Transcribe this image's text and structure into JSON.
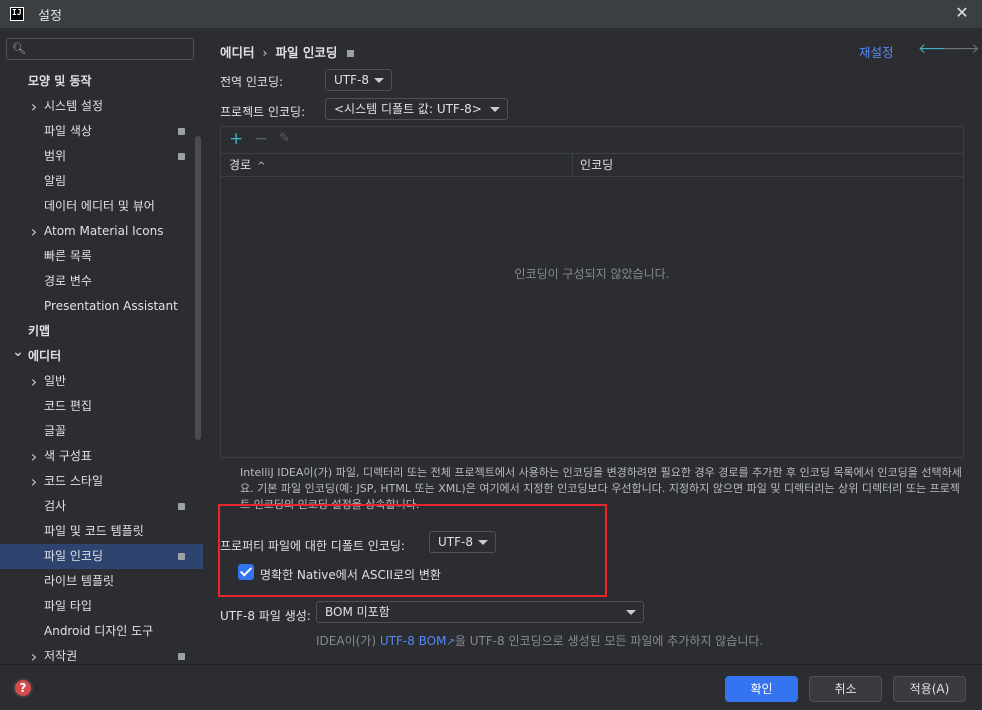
{
  "window": {
    "title": "설정",
    "logo": "IJ"
  },
  "search": {
    "placeholder": "",
    "value": ""
  },
  "sidebar": {
    "items": [
      {
        "label": "모양 및 동작",
        "bold": true,
        "level": 0
      },
      {
        "label": "시스템 설정",
        "arrow": "collapsed",
        "level": 1
      },
      {
        "label": "파일 색상",
        "level": 1,
        "badge": true
      },
      {
        "label": "범위",
        "level": 1,
        "badge": true
      },
      {
        "label": "알림",
        "level": 1
      },
      {
        "label": "데이터 에디터 및 뷰어",
        "level": 1
      },
      {
        "label": "Atom Material Icons",
        "arrow": "collapsed",
        "level": 1
      },
      {
        "label": "빠른 목록",
        "level": 1
      },
      {
        "label": "경로 변수",
        "level": 1
      },
      {
        "label": "Presentation Assistant",
        "level": 1
      },
      {
        "label": "키맵",
        "bold": true,
        "level": 0
      },
      {
        "label": "에디터",
        "bold": true,
        "arrow": "expanded",
        "level": 0
      },
      {
        "label": "일반",
        "arrow": "collapsed",
        "level": 1
      },
      {
        "label": "코드 편집",
        "level": 1
      },
      {
        "label": "글꼴",
        "level": 1
      },
      {
        "label": "색 구성표",
        "arrow": "collapsed",
        "level": 1
      },
      {
        "label": "코드 스타일",
        "arrow": "collapsed",
        "level": 1
      },
      {
        "label": "검사",
        "level": 1,
        "badge": true
      },
      {
        "label": "파일 및 코드 템플릿",
        "level": 1
      },
      {
        "label": "파일 인코딩",
        "level": 1,
        "badge": true,
        "selected": true
      },
      {
        "label": "라이브 템플릿",
        "level": 1
      },
      {
        "label": "파일 타입",
        "level": 1
      },
      {
        "label": "Android 디자인 도구",
        "level": 1
      },
      {
        "label": "저작권",
        "arrow": "collapsed",
        "level": 1,
        "badge": true
      }
    ]
  },
  "breadcrumb": {
    "parent": "에디터",
    "separator": "›",
    "current": "파일 인코딩"
  },
  "header": {
    "reset": "재설정",
    "back_icon": "🡐",
    "forward_icon": "🡒"
  },
  "global_encoding": {
    "label": "전역 인코딩:",
    "value": "UTF-8"
  },
  "project_encoding": {
    "label": "프로젝트 인코딩:",
    "value": "<시스템 디폴트 값: UTF-8>"
  },
  "table": {
    "add_icon": "+",
    "remove_icon": "−",
    "edit_icon": "✎",
    "columns": [
      "경로",
      "인코딩"
    ],
    "sort_icon": "^",
    "empty_message": "인코딩이 구성되지 않았습니다."
  },
  "description": "IntelliJ IDEA이(가) 파일, 디렉터리 또는 전체 프로젝트에서 사용하는 인코딩을 변경하려면 필요한 경우 경로를 추가한 후 인코딩 목록에서 인코딩을 선택하세요. 기본 파일 인코딩(예: JSP, HTML 또는 XML)은 여기에서 지정한 인코딩보다 우선합니다. 지정하지 않으면 파일 및 디렉터리는 상위 디렉터리 또는 프로젝트 인코딩의 인코딩 설정을 상속합니다.",
  "properties": {
    "label": "프로퍼티 파일에 대한 디폴트 인코딩:",
    "value": "UTF-8",
    "checkbox_label": "명확한 Native에서 ASCII로의 변환",
    "checkbox_checked": true
  },
  "bom": {
    "label": "UTF-8 파일 생성:",
    "value": "BOM 미포함",
    "note_prefix": "IDEA이(가) ",
    "note_link": "UTF-8 BOM",
    "note_link_icon": "↗",
    "note_suffix": "을 UTF-8 인코딩으로 생성된 모든 파일에 추가하지 않습니다."
  },
  "footer": {
    "help_icon": "?",
    "ok": "확인",
    "cancel": "취소",
    "apply": "적용(A)"
  },
  "colors": {
    "accent": "#3574f0",
    "link": "#548af7",
    "highlight_box": "#e8262d",
    "selected_row": "#2e436e"
  }
}
